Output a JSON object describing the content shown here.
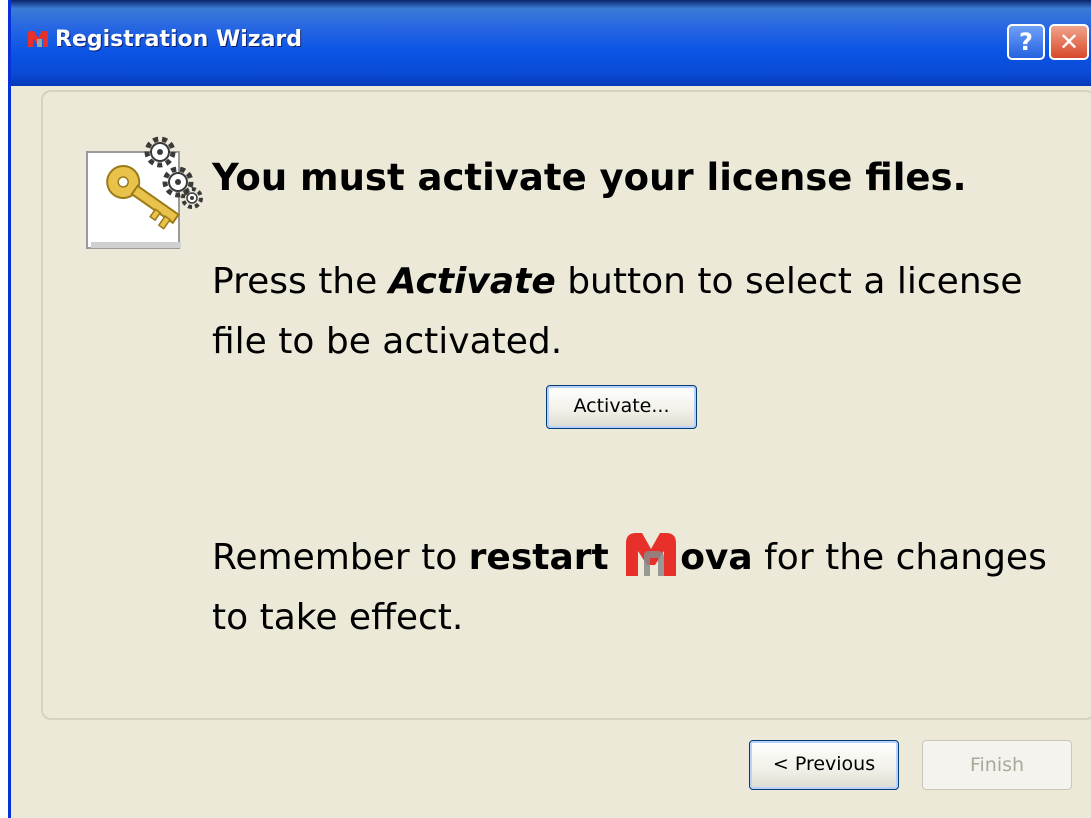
{
  "window": {
    "title": "Registration Wizard",
    "help_button": "?",
    "close_button": "✕"
  },
  "main": {
    "heading": "You must activate your license files.",
    "instruction_prefix": "Press the ",
    "instruction_emphasis": "Activate",
    "instruction_suffix": " button to select a license file to be activated.",
    "activate_button": "Activate...",
    "reminder_prefix": "Remember to ",
    "reminder_bold": "restart",
    "reminder_app": "ova",
    "reminder_suffix": " for the changes to take effect."
  },
  "footer": {
    "previous_button": "< Previous",
    "finish_button": "Finish"
  },
  "colors": {
    "titlebar": "#0b54e4",
    "window_bg": "#ece9d8",
    "logo_red": "#e8302a",
    "logo_gray": "#8a8a8a"
  }
}
